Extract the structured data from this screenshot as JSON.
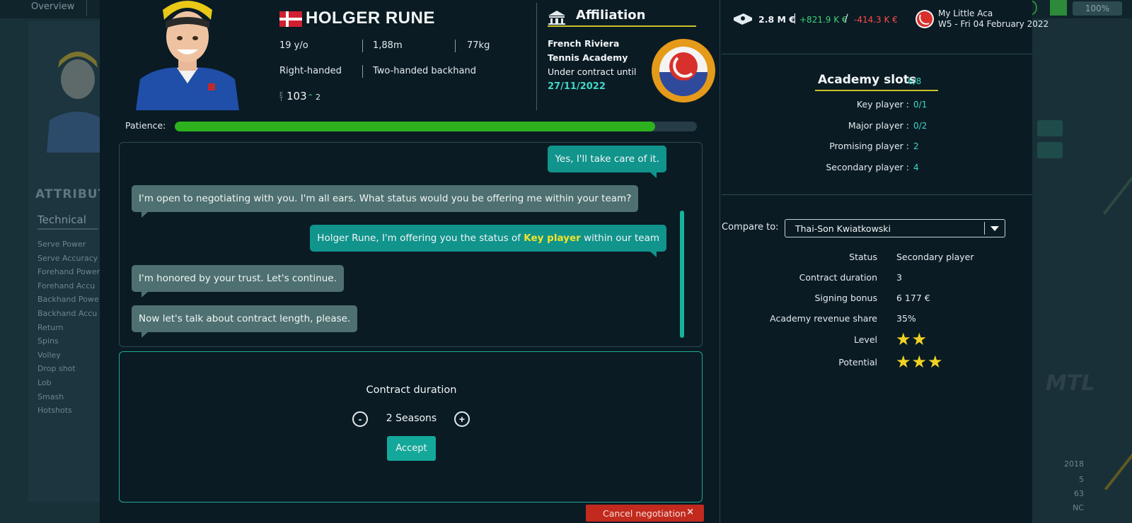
{
  "background": {
    "nav_tabs": [
      "Overview"
    ],
    "zoom": "100%",
    "section_title": "ATTRIBUT",
    "subsection_title": "Technical",
    "attribute_list": [
      "Serve Power",
      "Serve Accuracy",
      "Forehand Power",
      "Forehand Accu",
      "Backhand Powe",
      "Backhand Accu",
      "Return",
      "Spins",
      "Volley",
      "Drop shot",
      "Lob",
      "Smash",
      "Hotshots"
    ],
    "years": [
      "2018",
      "5",
      "63",
      "NC"
    ]
  },
  "player": {
    "name": "HOLGER RUNE",
    "flag": "denmark-flag",
    "age": "19 y/o",
    "height": "1,88m",
    "weight": "77kg",
    "hand": "Right-handed",
    "backhand": "Two-handed backhand",
    "rating": "103",
    "rating_change": "2"
  },
  "affiliation": {
    "title": "Affiliation",
    "academy_name": "French Riviera Tennis Academy",
    "contract_label": "Under contract until",
    "contract_date": "27/11/2022"
  },
  "patience": {
    "label": "Patience:",
    "level": 0.92,
    "color": "#2db21e"
  },
  "chat": {
    "messages": [
      {
        "from": "me",
        "text": "Yes, I'll take care of it."
      },
      {
        "from": "them",
        "text": "I'm open to negotiating with you. I'm all ears. What status would you be offering me within your team?"
      },
      {
        "from": "me",
        "text_before": "Holger Rune, I'm offering you the status of ",
        "highlight": "Key player",
        "text_after": " within our team"
      },
      {
        "from": "them",
        "text": "I'm honored by your trust. Let's continue."
      },
      {
        "from": "them",
        "text": "Now let's talk about contract length, please."
      }
    ]
  },
  "negotiation": {
    "title": "Contract duration",
    "value": "2 Seasons",
    "minus": "-",
    "plus": "+",
    "accept_label": "Accept",
    "cancel_label": "Cancel negotiation",
    "cancel_x": "×"
  },
  "header_right": {
    "balance": "2.8 M €",
    "income": "+821.9 K €",
    "expenses": "-414.3 K €",
    "separator_1": "|",
    "separator_2": "/",
    "club_name": "My Little Aca",
    "date": "W5 - Fri 04 February 2022"
  },
  "academy_slots": {
    "title": "Academy slots",
    "count": "6/8",
    "rows": [
      {
        "label": "Key player :",
        "value": "0/1"
      },
      {
        "label": "Major player :",
        "value": "0/2"
      },
      {
        "label": "Promising player :",
        "value": "2"
      },
      {
        "label": "Secondary player :",
        "value": "4"
      }
    ]
  },
  "compare": {
    "label": "Compare to:",
    "selected": "Thai-Son Kwiatkowski",
    "rows": [
      {
        "label": "Status",
        "value": "Secondary player"
      },
      {
        "label": "Contract duration",
        "value": "3"
      },
      {
        "label": "Signing bonus",
        "value": "6 177 €"
      },
      {
        "label": "Academy revenue share",
        "value": "35%"
      }
    ],
    "level_label": "Level",
    "level_stars": "★★",
    "potential_label": "Potential",
    "potential_stars": "★★★",
    "star_color": "#f0d322"
  }
}
